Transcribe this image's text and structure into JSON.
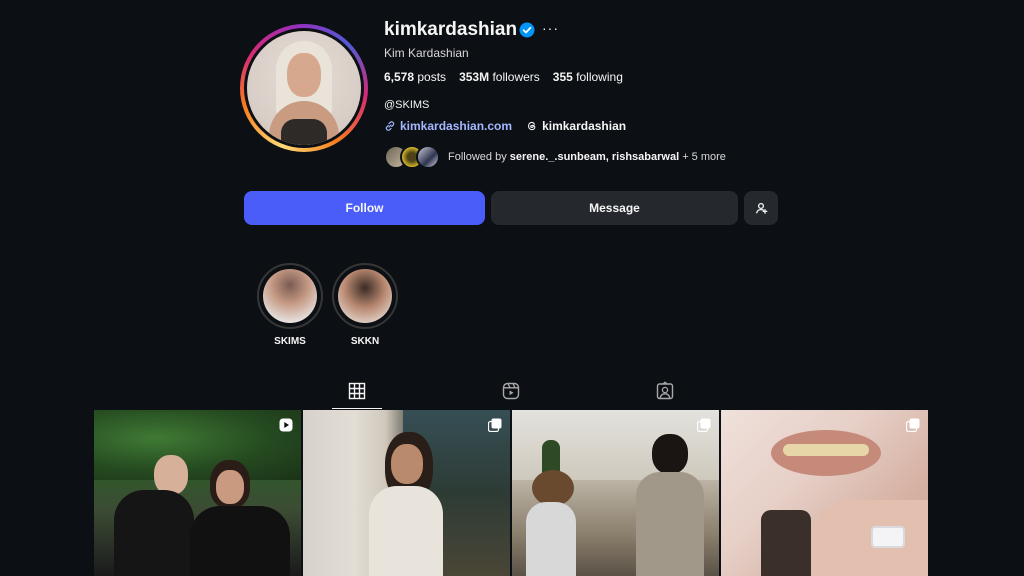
{
  "profile": {
    "username": "kimkardashian",
    "full_name": "Kim Kardashian",
    "stats": {
      "posts_count": "6,578",
      "posts_label": "posts",
      "followers_count": "353M",
      "followers_label": "followers",
      "following_count": "355",
      "following_label": "following"
    },
    "bio": "@SKIMS",
    "website": "kimkardashian.com",
    "threads_handle": "kimkardashian",
    "followed_by_prefix": "Followed by",
    "followed_by_names": "serene._.sunbeam, rishsabarwal",
    "followed_by_more": "+ 5 more"
  },
  "actions": {
    "follow_label": "Follow",
    "message_label": "Message"
  },
  "highlights": [
    {
      "label": "SKIMS"
    },
    {
      "label": "SKKN"
    }
  ],
  "tabs": [
    {
      "icon": "grid-icon",
      "active": true
    },
    {
      "icon": "reels-icon",
      "active": false
    },
    {
      "icon": "tagged-icon",
      "active": false
    }
  ],
  "posts": [
    {
      "type": "reel",
      "icon": "reel-icon"
    },
    {
      "type": "carousel",
      "icon": "carousel-icon"
    },
    {
      "type": "carousel",
      "icon": "carousel-icon"
    },
    {
      "type": "carousel",
      "icon": "carousel-icon"
    }
  ],
  "colors": {
    "background": "#0c1014",
    "follow_button": "#4a5df9",
    "secondary_button": "#25292e",
    "link": "#a3b8ff",
    "verified": "#0095f6"
  }
}
